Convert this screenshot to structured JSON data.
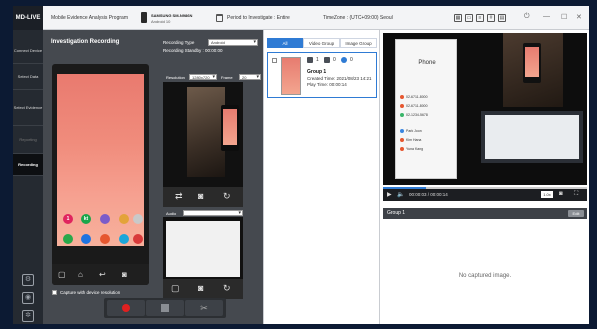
{
  "app": {
    "logo": "MD-LIVE",
    "title": "Mobile Evidence Analysis Program",
    "device_name": "SAMSUNG SM-N986N",
    "device_os": "Android 10",
    "period": "Period to Investigate : Entire",
    "timezone": "TimeZone : (UTC+09:00) Seoul"
  },
  "topbar_icons": [
    "grid-icon",
    "monitor-icon",
    "list-icon",
    "hash-icon",
    "calendar-icon",
    "power-icon",
    "minimize-icon",
    "close-icon"
  ],
  "nav": {
    "items": [
      {
        "label": "Connect Device",
        "state": "normal"
      },
      {
        "label": "Select Data",
        "state": "normal"
      },
      {
        "label": "Select Evidence",
        "state": "normal"
      },
      {
        "label": "Reporting",
        "state": "dim"
      },
      {
        "label": "Recording",
        "state": "active"
      }
    ]
  },
  "recording": {
    "title": "Investigation Recording",
    "type_label": "Recording Type",
    "type_value": "Android",
    "standby": "Recording Standby : 00:00:00",
    "resolution_label": "Resolution",
    "resolution_value": "1280x720",
    "frame_label": "Frame",
    "frame_value": "20",
    "audio_label": "Audio",
    "audio_value": "",
    "capture_checkbox_label": "Capture with device resolution"
  },
  "phone_apps": [
    {
      "label": "1",
      "color": "#e0245e"
    },
    {
      "label": "kt",
      "color": "#19a64a"
    },
    {
      "label": "",
      "color": "#7b5cc9"
    },
    {
      "label": "",
      "color": "#e3a33a"
    },
    {
      "label": "",
      "color": "#c9c9c9"
    },
    {
      "label": "",
      "color": "#2aa84a"
    },
    {
      "label": "",
      "color": "#1f73e0"
    },
    {
      "label": "",
      "color": "#e6572f"
    },
    {
      "label": "",
      "color": "#1ca6d9"
    },
    {
      "label": "",
      "color": "#d93a3a"
    }
  ],
  "tabs": [
    {
      "label": "All",
      "active": true
    },
    {
      "label": "Video Group",
      "active": false
    },
    {
      "label": "Image Group",
      "active": false
    }
  ],
  "group_card": {
    "video_count": "1",
    "image_count": "0",
    "share_count": "0",
    "title": "Group 1",
    "created": "Created Time: 2021/08/23 14:21",
    "play": "Play Time: 00:00:14"
  },
  "viewer": {
    "phone_title": "Phone",
    "calls": [
      {
        "name": "02-6711-8000",
        "color": "#e6572f"
      },
      {
        "name": "02-6711-8000",
        "color": "#e6572f"
      },
      {
        "name": "02-1234-5678",
        "color": "#3ab56a"
      },
      {
        "name": "Park Joon",
        "color": "#3a86e0"
      },
      {
        "name": "Kim Hana",
        "color": "#e6572f"
      },
      {
        "name": "Yuna Kang",
        "color": "#e6572f"
      }
    ],
    "time": "00:00:03 / 00:00:14",
    "progress": 0.21,
    "rate": "1.0x",
    "group_label": "Group 1",
    "group_button": "Edit",
    "no_capture": "No captured image."
  }
}
